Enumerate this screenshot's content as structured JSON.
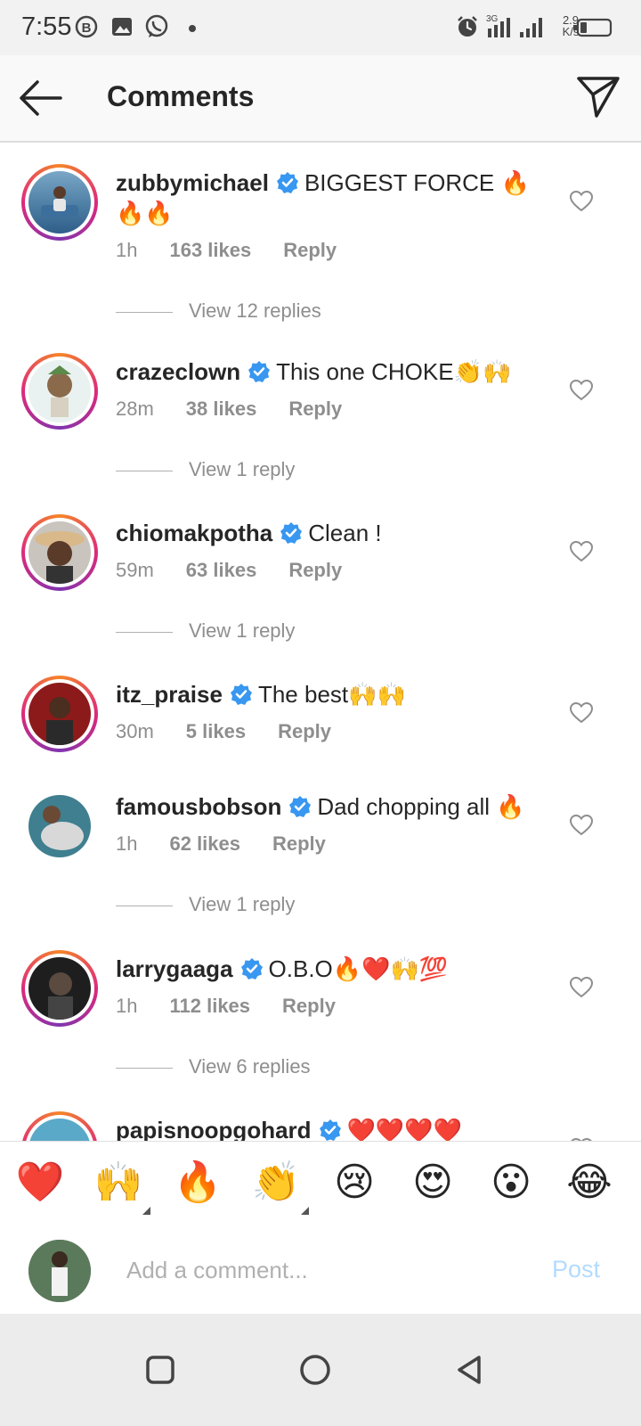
{
  "status_bar": {
    "time": "7:55",
    "net_speed_value": "2.9",
    "net_speed_unit": "K/s",
    "left_icons": [
      "b-circle-icon",
      "gallery-icon",
      "whatsapp-icon"
    ],
    "right_icons": [
      "alarm-icon",
      "signal-3g-icon",
      "signal-icon",
      "battery-icon"
    ]
  },
  "header": {
    "title": "Comments"
  },
  "comments": [
    {
      "username": "zubbymichael",
      "text": "BIGGEST FORCE 🔥🔥🔥",
      "time": "1h",
      "likes": "163 likes",
      "reply": "Reply",
      "view_replies": "View 12 replies",
      "verified": true
    },
    {
      "username": "crazeclown",
      "text": "This one CHOKE👏🙌",
      "time": "28m",
      "likes": "38 likes",
      "reply": "Reply",
      "view_replies": "View 1 reply",
      "verified": true
    },
    {
      "username": "chiomakpotha",
      "text": "Clean !",
      "time": "59m",
      "likes": "63 likes",
      "reply": "Reply",
      "view_replies": "View 1 reply",
      "verified": true
    },
    {
      "username": "itz_praise",
      "text": "The best🙌🙌",
      "time": "30m",
      "likes": "5 likes",
      "reply": "Reply",
      "view_replies": "",
      "verified": true
    },
    {
      "username": "famousbobson",
      "text": "Dad chopping all 🔥",
      "time": "1h",
      "likes": "62 likes",
      "reply": "Reply",
      "view_replies": "View 1 reply",
      "verified": true
    },
    {
      "username": "larrygaaga",
      "text": "O.B.O🔥❤️🙌💯",
      "time": "1h",
      "likes": "112 likes",
      "reply": "Reply",
      "view_replies": "View 6 replies",
      "verified": true
    },
    {
      "username": "papisnoopgohard",
      "text": "❤️❤️❤️❤️",
      "time": "",
      "likes": "",
      "reply": "",
      "view_replies": "",
      "verified": true
    }
  ],
  "reactions": [
    "❤️",
    "🙌",
    "🔥",
    "👏",
    "😢",
    "😍",
    "😮",
    "😂"
  ],
  "composer": {
    "placeholder": "Add a comment...",
    "post_label": "Post"
  },
  "colors": {
    "accent_blue": "#3897f0",
    "post_disabled": "#b3dbff",
    "meta_gray": "#8e8e8e",
    "text": "#262626"
  }
}
